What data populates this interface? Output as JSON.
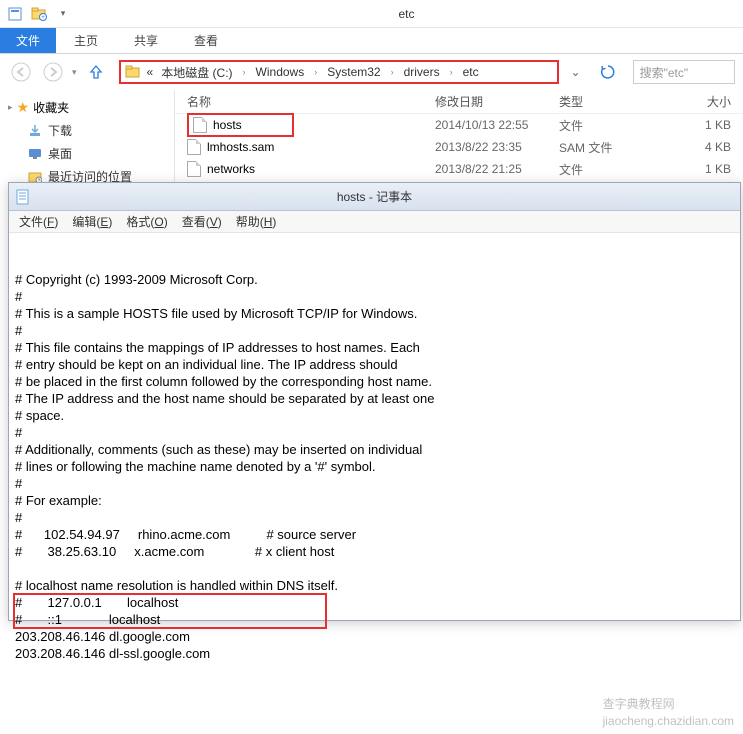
{
  "explorer": {
    "title": "etc",
    "ribbon": {
      "file": "文件",
      "tabs": [
        "主页",
        "共享",
        "查看"
      ]
    },
    "breadcrumb": {
      "prefix": "«",
      "items": [
        "本地磁盘 (C:)",
        "Windows",
        "System32",
        "drivers",
        "etc"
      ]
    },
    "search_placeholder": "搜索\"etc\"",
    "nav": {
      "favorites": "收藏夹",
      "items": [
        "下载",
        "桌面",
        "最近访问的位置"
      ]
    },
    "columns": {
      "name": "名称",
      "date": "修改日期",
      "type": "类型",
      "size": "大小"
    },
    "files": [
      {
        "name": "hosts",
        "date": "2014/10/13 22:55",
        "type": "文件",
        "size": "1 KB",
        "hl": true
      },
      {
        "name": "lmhosts.sam",
        "date": "2013/8/22 23:35",
        "type": "SAM 文件",
        "size": "4 KB",
        "hl": false
      },
      {
        "name": "networks",
        "date": "2013/8/22 21:25",
        "type": "文件",
        "size": "1 KB",
        "hl": false
      }
    ]
  },
  "notepad": {
    "title": "hosts - 记事本",
    "menu": [
      {
        "label": "文件",
        "hk": "F"
      },
      {
        "label": "编辑",
        "hk": "E"
      },
      {
        "label": "格式",
        "hk": "O"
      },
      {
        "label": "查看",
        "hk": "V"
      },
      {
        "label": "帮助",
        "hk": "H"
      }
    ],
    "body": "# Copyright (c) 1993-2009 Microsoft Corp.\n#\n# This is a sample HOSTS file used by Microsoft TCP/IP for Windows.\n#\n# This file contains the mappings of IP addresses to host names. Each\n# entry should be kept on an individual line. The IP address should\n# be placed in the first column followed by the corresponding host name.\n# The IP address and the host name should be separated by at least one\n# space.\n#\n# Additionally, comments (such as these) may be inserted on individual\n# lines or following the machine name denoted by a '#' symbol.\n#\n# For example:\n#\n#      102.54.94.97     rhino.acme.com          # source server\n#       38.25.63.10     x.acme.com              # x client host\n\n# localhost name resolution is handled within DNS itself.\n#       127.0.0.1       localhost\n#       ::1             localhost\n203.208.46.146 dl.google.com\n203.208.46.146 dl-ssl.google.com",
    "highlight_lines": [
      21,
      22
    ]
  },
  "watermark": "查字典教程网\njiaocheng.chazidian.com"
}
